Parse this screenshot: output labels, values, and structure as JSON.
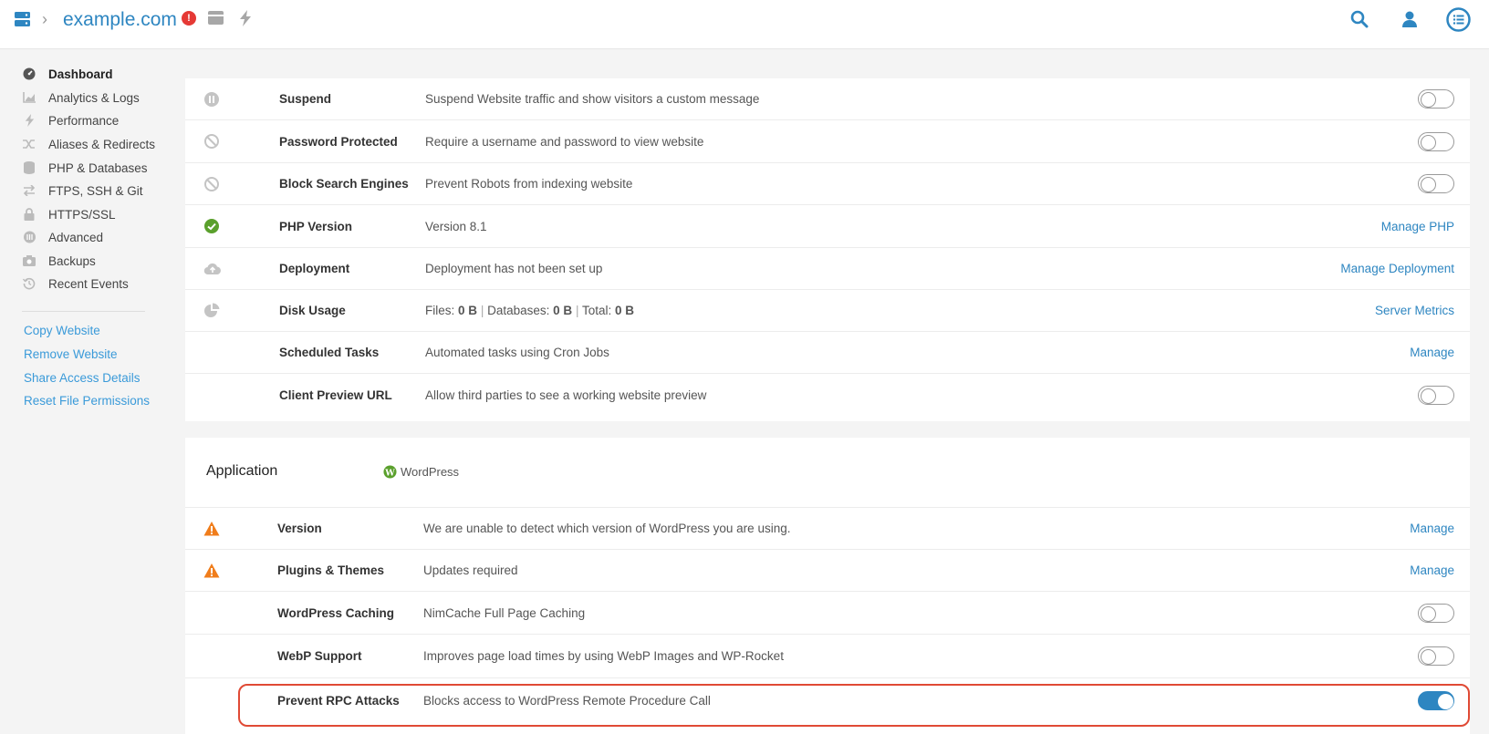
{
  "topbar": {
    "domain": "example.com",
    "alert": "!",
    "icons": [
      "server-icon",
      "card-icon",
      "bolt-icon",
      "search-icon",
      "user-icon",
      "menu-list-icon"
    ]
  },
  "sidebar": {
    "items": [
      {
        "label": "Dashboard",
        "icon": "dashboard-icon",
        "active": true
      },
      {
        "label": "Analytics & Logs",
        "icon": "chart-icon"
      },
      {
        "label": "Performance",
        "icon": "bolt-icon"
      },
      {
        "label": "Aliases & Redirects",
        "icon": "shuffle-icon"
      },
      {
        "label": "PHP & Databases",
        "icon": "database-icon"
      },
      {
        "label": "FTPS, SSH & Git",
        "icon": "transfer-icon"
      },
      {
        "label": "HTTPS/SSL",
        "icon": "lock-icon"
      },
      {
        "label": "Advanced",
        "icon": "flask-icon"
      },
      {
        "label": "Backups",
        "icon": "camera-icon"
      },
      {
        "label": "Recent Events",
        "icon": "history-icon"
      }
    ],
    "links": [
      "Copy Website",
      "Remove Website",
      "Share Access Details",
      "Reset File Permissions"
    ]
  },
  "settings": {
    "rows": [
      {
        "title": "Suspend",
        "desc": "Suspend Website traffic and show visitors a custom message",
        "icon": "pause-icon",
        "control": "toggle",
        "on": false
      },
      {
        "title": "Password Protected",
        "desc": "Require a username and password to view website",
        "icon": "blocked-icon",
        "control": "toggle",
        "on": false
      },
      {
        "title": "Block Search Engines",
        "desc": "Prevent Robots from indexing website",
        "icon": "blocked-icon",
        "control": "toggle",
        "on": false
      },
      {
        "title": "PHP Version",
        "desc": "Version 8.1",
        "icon": "check-circle-icon",
        "control": "link",
        "link": "Manage PHP"
      },
      {
        "title": "Deployment",
        "desc": "Deployment has not been set up",
        "icon": "cloud-upload-icon",
        "control": "link",
        "link": "Manage Deployment"
      },
      {
        "title": "Disk Usage",
        "icon": "pie-chart-icon",
        "control": "link",
        "link": "Server Metrics",
        "disk": {
          "files_label": "Files:",
          "files": "0 B",
          "db_label": "Databases:",
          "db": "0 B",
          "total_label": "Total:",
          "total": "0 B"
        }
      },
      {
        "title": "Scheduled Tasks",
        "desc": "Automated tasks using Cron Jobs",
        "control": "link",
        "link": "Manage"
      },
      {
        "title": "Client Preview URL",
        "desc": "Allow third parties to see a working website preview",
        "control": "toggle",
        "on": false
      }
    ]
  },
  "application": {
    "heading": "Application",
    "platform": "WordPress",
    "rows": [
      {
        "title": "Version",
        "desc": "We are unable to detect which version of WordPress you are using.",
        "icon": "warning-icon",
        "control": "link",
        "link": "Manage"
      },
      {
        "title": "Plugins & Themes",
        "desc": "Updates required",
        "icon": "warning-icon",
        "control": "link",
        "link": "Manage"
      },
      {
        "title": "WordPress Caching",
        "desc": "NimCache Full Page Caching",
        "control": "toggle",
        "on": false
      },
      {
        "title": "WebP Support",
        "desc": "Improves page load times by using WebP Images and WP-Rocket",
        "control": "toggle",
        "on": false
      },
      {
        "title": "Prevent RPC Attacks",
        "desc": "Blocks access to WordPress Remote Procedure Call",
        "control": "toggle",
        "on": true
      }
    ]
  },
  "colors": {
    "accent": "#2e86c1",
    "link": "#3a9ad9",
    "warning": "#f07d1b",
    "success": "#5aa02c",
    "highlight": "#e04a35"
  }
}
